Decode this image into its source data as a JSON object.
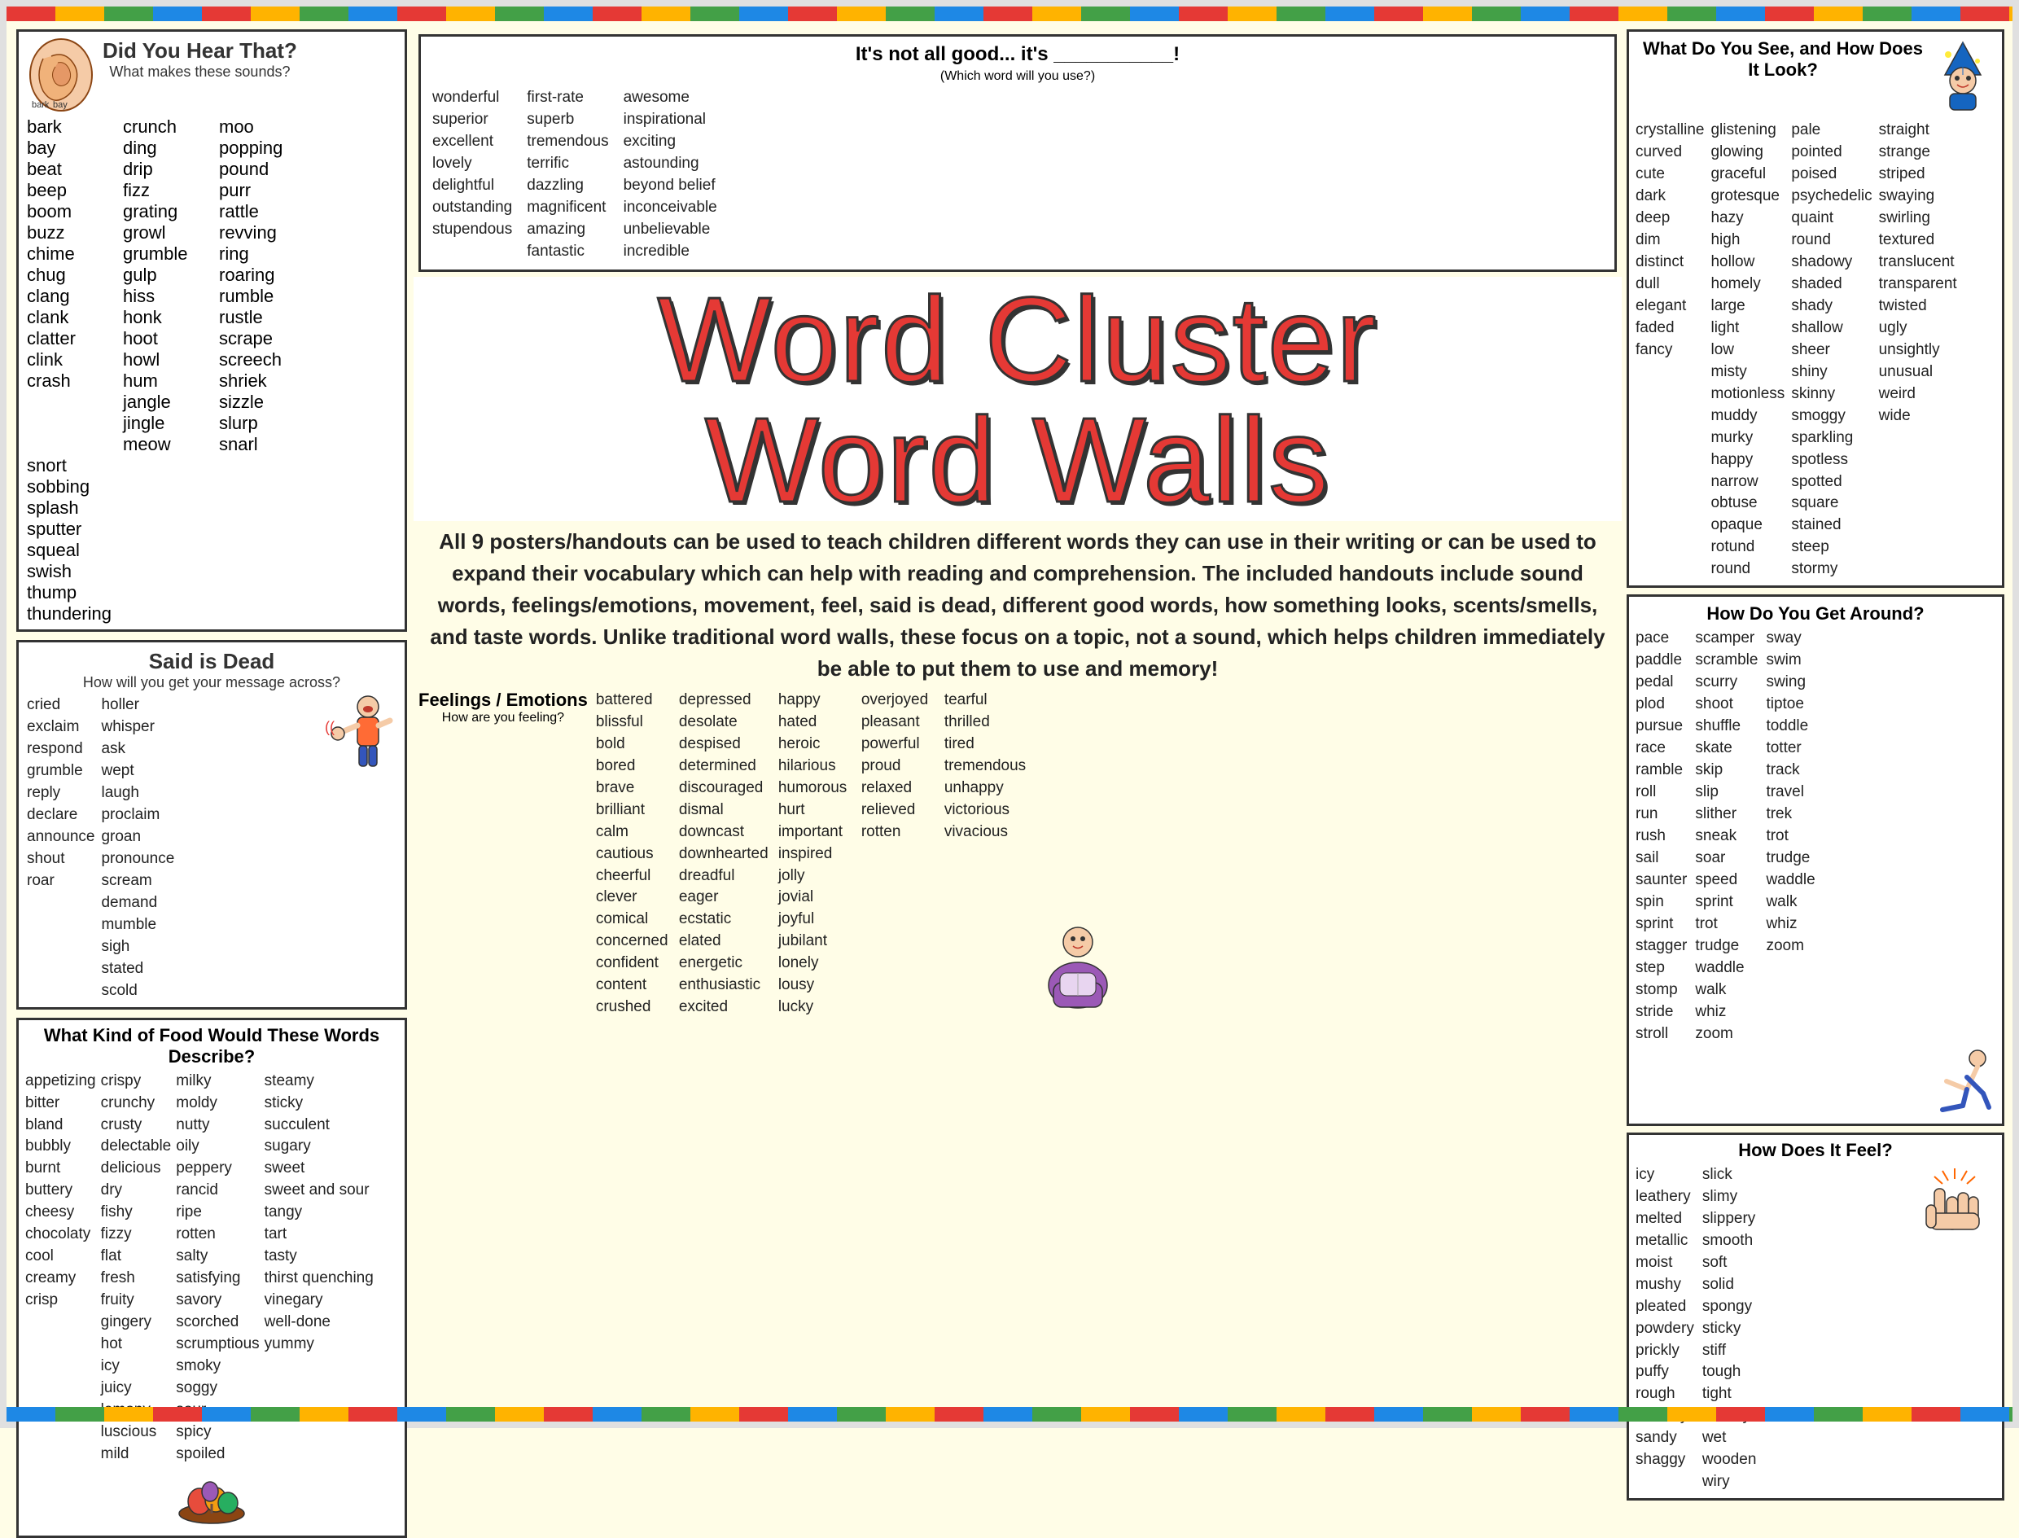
{
  "topBorder": true,
  "sound": {
    "title": "Did You Hear That?",
    "subtitle": "What makes these sounds?",
    "col1": [
      "bark",
      "bay",
      "beat",
      "beep",
      "boom",
      "buzz",
      "chime",
      "chug",
      "clang",
      "clank",
      "clatter",
      "clink",
      "crash"
    ],
    "col2": [
      "crunch",
      "ding",
      "drip",
      "fizz",
      "grating",
      "growl",
      "grumble",
      "gulp",
      "hiss",
      "honk",
      "hoot",
      "howl",
      "hum",
      "jangle",
      "jingle",
      "meow"
    ],
    "col3": [
      "moo",
      "popping",
      "pound",
      "purr",
      "rattle",
      "revving",
      "ring",
      "roaring",
      "rumble",
      "rustle",
      "scrape",
      "screech",
      "shriek",
      "sizzle",
      "slurp",
      "snarl"
    ],
    "col4": [
      "snort",
      "sobbing",
      "splash",
      "sputter",
      "squeal",
      "swish",
      "thump",
      "thundering"
    ]
  },
  "saidIsDead": {
    "title": "Said is Dead",
    "subtitle": "How will you get your message across?",
    "col1": [
      "cried",
      "exclaim",
      "respond",
      "grumble",
      "reply",
      "declare",
      "announce",
      "shout",
      "roar"
    ],
    "col2": [
      "holler",
      "whisper",
      "ask",
      "wept",
      "laugh",
      "proclaim",
      "groan",
      "pronounce",
      "scream",
      "demand",
      "mumble",
      "sigh",
      "stated",
      "scold"
    ]
  },
  "taste": {
    "title": "What Kind of Food Would These Words Describe?",
    "col1": [
      "appetizing",
      "bitter",
      "bland",
      "bubbly",
      "burnt",
      "buttery",
      "cheesy",
      "chocolaty",
      "cool",
      "creamy",
      "crisp"
    ],
    "col2": [
      "crispy",
      "crunchy",
      "crusty",
      "delectable",
      "delicious",
      "dry",
      "fishy",
      "fizzy",
      "flat",
      "fresh",
      "fruity",
      "gingery",
      "hot",
      "icy",
      "juicy",
      "lemony",
      "luscious",
      "mild"
    ],
    "col3": [
      "milky",
      "moldy",
      "nutty",
      "oily",
      "peppery",
      "rancid",
      "ripe",
      "rotten",
      "salty",
      "satisfying",
      "savory",
      "scorched",
      "scrumptious",
      "smoky",
      "soggy",
      "sour",
      "spicy",
      "spoiled"
    ],
    "col4": [
      "steamy",
      "sticky",
      "succulent",
      "sugary",
      "sweet",
      "sweet and sour",
      "tangy",
      "tart",
      "tasty",
      "thirst quenching",
      "vinegary",
      "well-done",
      "yummy"
    ]
  },
  "goodWords": {
    "title": "It's not all good... it's ___________!",
    "subtitle": "(Which word will you use?)",
    "col1": [
      "wonderful",
      "superior",
      "excellent",
      "lovely",
      "delightful",
      "outstanding",
      "stupendous"
    ],
    "col2": [
      "first-rate",
      "superb",
      "tremendous",
      "terrific",
      "dazzling",
      "magnificent",
      "amazing",
      "fantastic"
    ],
    "col3": [
      "awesome",
      "inspirational",
      "exciting",
      "astounding",
      "beyond belief",
      "inconceivable",
      "unbelievable",
      "incredible"
    ],
    "col4": []
  },
  "mainTitle": {
    "line1": "Word Cluster",
    "line2": "Word Walls"
  },
  "description": "All 9 posters/handouts can be used to teach children different words they can use in their writing or can be used to expand their vocabulary which can help with reading and comprehension. The included handouts include sound words, feelings/emotions, movement, feel, said is dead, different good words, how something looks, scents/smells, and taste words. Unlike traditional word walls, these focus on a topic, not a sound, which helps children immediately be able to put them to use and memory!",
  "feelings": {
    "title": "Feelings / Emotions",
    "subtitle": "How are you feeling?",
    "col1": [
      "battered",
      "blissful",
      "bold",
      "bored",
      "brave",
      "brilliant",
      "calm",
      "cautious",
      "cheerful",
      "clever",
      "comical",
      "concerned",
      "confident",
      "content",
      "crushed"
    ],
    "col2": [
      "depressed",
      "desolate",
      "despised",
      "determined",
      "discouraged",
      "dismal",
      "downcast",
      "downhearted",
      "dreadful",
      "eager",
      "ecstatic",
      "elated",
      "energetic",
      "enthusiastic",
      "excited"
    ],
    "col3": [
      "happy",
      "hated",
      "heroic",
      "hilarious",
      "humorous",
      "hurt",
      "important",
      "inspired",
      "jolly",
      "jovial",
      "joyful",
      "jubilant",
      "lonely",
      "lousy",
      "lucky"
    ],
    "col4": [
      "overjoyed",
      "pleasant",
      "powerful",
      "proud",
      "relaxed",
      "relieved",
      "rotten"
    ],
    "col5": [
      "tearful",
      "thrilled",
      "tired",
      "tremendous",
      "unhappy",
      "victorious",
      "vivacious"
    ]
  },
  "looks": {
    "title": "What Do You See, and How Does It Look?",
    "col1": [
      "crystalline",
      "curved",
      "cute",
      "dark",
      "deep",
      "dim",
      "distinct",
      "dull",
      "elegant",
      "faded",
      "fancy"
    ],
    "col2": [
      "glistening",
      "glowing",
      "graceful",
      "grotesque",
      "hazy",
      "high",
      "hollow",
      "homely",
      "large",
      "light",
      "low",
      "misty",
      "motionless",
      "muddy",
      "murky",
      "happy",
      "narrow",
      "obtuse",
      "opaque",
      "rotund",
      "round"
    ],
    "col3": [
      "pale",
      "pointed",
      "poised",
      "psychedelic",
      "quaint",
      "round",
      "shadowy",
      "shaded",
      "shady",
      "shallow",
      "sheer",
      "shiny",
      "skinny",
      "smoggy",
      "sparkling",
      "spotless",
      "spotted",
      "square",
      "stained",
      "steep",
      "stormy"
    ],
    "col4": [
      "straight",
      "strange",
      "striped",
      "swaying",
      "swirling",
      "textured",
      "translucent",
      "transparent",
      "twisted",
      "ugly",
      "unsightly",
      "unusual",
      "weird",
      "wide"
    ]
  },
  "movement": {
    "title": "How Do You Get Around?",
    "col1": [
      "pace",
      "paddle",
      "pedal",
      "plod",
      "pursue",
      "race",
      "ramble",
      "roll",
      "run",
      "rush",
      "sail",
      "saunter",
      "spin",
      "sprint",
      "stagger",
      "step",
      "stomp",
      "stride",
      "stroll"
    ],
    "col2": [
      "scamper",
      "scramble",
      "scurry",
      "shoot",
      "shuffle",
      "skate",
      "skip",
      "slip",
      "slither",
      "sneak",
      "soar",
      "speed",
      "sprint",
      "trot",
      "trudge",
      "waddle",
      "walk",
      "whiz",
      "zoom"
    ],
    "col3": [
      "sway",
      "swim",
      "swing",
      "tiptoe",
      "toddle",
      "totter",
      "track",
      "travel",
      "trek",
      "trot",
      "trudge",
      "waddle",
      "walk",
      "whiz",
      "zoom"
    ]
  },
  "feel": {
    "title": "How Does It Feel?",
    "col1": [
      "icy",
      "leathery",
      "melted",
      "metallic",
      "moist",
      "mushy",
      "pleated",
      "powdery",
      "prickly",
      "puffy",
      "rough",
      "rubbery",
      "sandy",
      "shaggy"
    ],
    "col2": [
      "slick",
      "slimy",
      "slippery",
      "smooth",
      "soft",
      "solid",
      "spongy",
      "sticky",
      "stiff",
      "tough",
      "tight",
      "velvety",
      "wet",
      "wooden",
      "wiry"
    ]
  }
}
